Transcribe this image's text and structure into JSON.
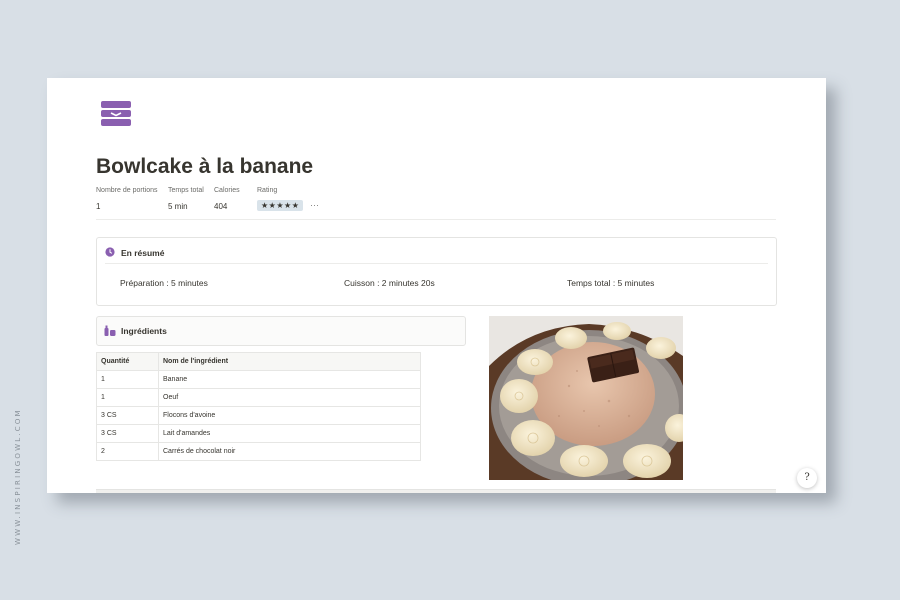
{
  "watermark": "WWW.INSPIRINGOWL.COM",
  "page": {
    "icon": "recipe-box-icon",
    "title": "Bowlcake à la banane"
  },
  "properties": [
    {
      "label": "Nombre de portions",
      "value": "1"
    },
    {
      "label": "Temps total",
      "value": "5 min"
    },
    {
      "label": "Calories",
      "value": "404"
    },
    {
      "label": "Rating",
      "value": "★★★★★",
      "stars": 5
    }
  ],
  "more_label": "···",
  "summary": {
    "icon": "clock-icon",
    "title": "En résumé",
    "items": [
      "Préparation : 5 minutes",
      "Cuisson : 2 minutes 20s",
      "Temps total : 5 minutes"
    ]
  },
  "ingredients": {
    "icon": "ingredients-icon",
    "title": "Ingrédients",
    "columns": [
      "Quantité",
      "Nom de l'ingrédient"
    ],
    "rows": [
      [
        "1",
        "Banane"
      ],
      [
        "1",
        "Oeuf"
      ],
      [
        "3 CS",
        "Flocons d'avoine"
      ],
      [
        "3 CS",
        "Lait d'amandes"
      ],
      [
        "2",
        "Carrés de chocolat noir"
      ]
    ]
  },
  "photo": {
    "subject": "bowlcake-with-banana-slices-photo"
  },
  "help_button": "?",
  "colors": {
    "background": "#d8dfe6",
    "accent_purple": "#8a5fb0",
    "rating_badge": "#d9e3ea"
  }
}
